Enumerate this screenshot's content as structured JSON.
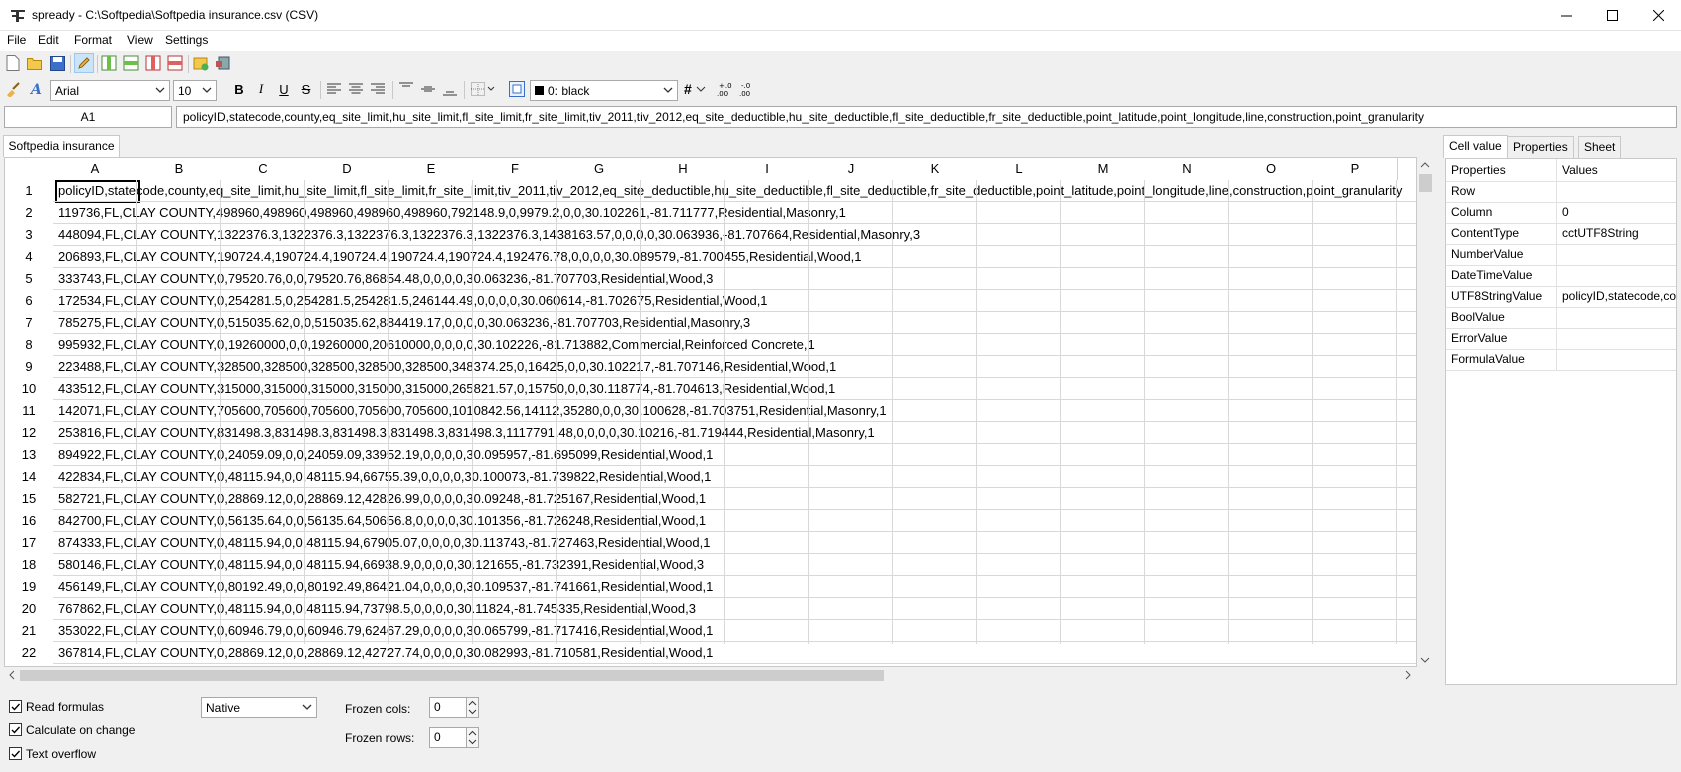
{
  "window": {
    "title": "spready - C:\\Softpedia\\Softpedia insurance.csv (CSV)"
  },
  "menu": [
    "File",
    "Edit",
    "Format",
    "View",
    "Settings"
  ],
  "toolbar": {
    "font_name": "Arial",
    "font_size": "10",
    "bold_label": "B",
    "italic_label": "I",
    "underline_label": "U",
    "strike_label": "S",
    "color_value": "0: black",
    "number_format_label": "#"
  },
  "cell_ref": "A1",
  "formula_value": "policyID,statecode,county,eq_site_limit,hu_site_limit,fl_site_limit,fr_site_limit,tiv_2011,tiv_2012,eq_site_deductible,hu_site_deductible,fl_site_deductible,fr_site_deductible,point_latitude,point_longitude,line,construction,point_granularity",
  "sheet_tab": "Softpedia insurance",
  "columns": [
    "A",
    "B",
    "C",
    "D",
    "E",
    "F",
    "G",
    "H",
    "I",
    "J",
    "K",
    "L",
    "M",
    "N",
    "O",
    "P"
  ],
  "rows": [
    {
      "n": "1",
      "text": "policyID,statecode,county,eq_site_limit,hu_site_limit,fl_site_limit,fr_site_limit,tiv_2011,tiv_2012,eq_site_deductible,hu_site_deductible,fl_site_deductible,fr_site_deductible,point_latitude,point_longitude,line,construction,point_granularity"
    },
    {
      "n": "2",
      "text": "119736,FL,CLAY COUNTY,498960,498960,498960,498960,498960,792148.9,0,9979.2,0,0,30.102261,-81.711777,Residential,Masonry,1"
    },
    {
      "n": "3",
      "text": "448094,FL,CLAY COUNTY,1322376.3,1322376.3,1322376.3,1322376.3,1322376.3,1438163.57,0,0,0,0,30.063936,-81.707664,Residential,Masonry,3"
    },
    {
      "n": "4",
      "text": "206893,FL,CLAY COUNTY,190724.4,190724.4,190724.4,190724.4,190724.4,192476.78,0,0,0,0,30.089579,-81.700455,Residential,Wood,1"
    },
    {
      "n": "5",
      "text": "333743,FL,CLAY COUNTY,0,79520.76,0,0,79520.76,86854.48,0,0,0,0,30.063236,-81.707703,Residential,Wood,3"
    },
    {
      "n": "6",
      "text": "172534,FL,CLAY COUNTY,0,254281.5,0,254281.5,254281.5,246144.49,0,0,0,0,30.060614,-81.702675,Residential,Wood,1"
    },
    {
      "n": "7",
      "text": "785275,FL,CLAY COUNTY,0,515035.62,0,0,515035.62,884419.17,0,0,0,0,30.063236,-81.707703,Residential,Masonry,3"
    },
    {
      "n": "8",
      "text": "995932,FL,CLAY COUNTY,0,19260000,0,0,19260000,20610000,0,0,0,0,30.102226,-81.713882,Commercial,Reinforced Concrete,1"
    },
    {
      "n": "9",
      "text": "223488,FL,CLAY COUNTY,328500,328500,328500,328500,328500,348374.25,0,16425,0,0,30.102217,-81.707146,Residential,Wood,1"
    },
    {
      "n": "10",
      "text": "433512,FL,CLAY COUNTY,315000,315000,315000,315000,315000,265821.57,0,15750,0,0,30.118774,-81.704613,Residential,Wood,1"
    },
    {
      "n": "11",
      "text": "142071,FL,CLAY COUNTY,705600,705600,705600,705600,705600,1010842.56,14112,35280,0,0,30.100628,-81.703751,Residential,Masonry,1"
    },
    {
      "n": "12",
      "text": "253816,FL,CLAY COUNTY,831498.3,831498.3,831498.3,831498.3,831498.3,1117791.48,0,0,0,0,30.10216,-81.719444,Residential,Masonry,1"
    },
    {
      "n": "13",
      "text": "894922,FL,CLAY COUNTY,0,24059.09,0,0,24059.09,33952.19,0,0,0,0,30.095957,-81.695099,Residential,Wood,1"
    },
    {
      "n": "14",
      "text": "422834,FL,CLAY COUNTY,0,48115.94,0,0,48115.94,66755.39,0,0,0,0,30.100073,-81.739822,Residential,Wood,1"
    },
    {
      "n": "15",
      "text": "582721,FL,CLAY COUNTY,0,28869.12,0,0,28869.12,42826.99,0,0,0,0,30.09248,-81.725167,Residential,Wood,1"
    },
    {
      "n": "16",
      "text": "842700,FL,CLAY COUNTY,0,56135.64,0,0,56135.64,50656.8,0,0,0,0,30.101356,-81.726248,Residential,Wood,1"
    },
    {
      "n": "17",
      "text": "874333,FL,CLAY COUNTY,0,48115.94,0,0,48115.94,67905.07,0,0,0,0,30.113743,-81.727463,Residential,Wood,1"
    },
    {
      "n": "18",
      "text": "580146,FL,CLAY COUNTY,0,48115.94,0,0,48115.94,66938.9,0,0,0,0,30.121655,-81.732391,Residential,Wood,3"
    },
    {
      "n": "19",
      "text": "456149,FL,CLAY COUNTY,0,80192.49,0,0,80192.49,86421.04,0,0,0,0,30.109537,-81.741661,Residential,Wood,1"
    },
    {
      "n": "20",
      "text": "767862,FL,CLAY COUNTY,0,48115.94,0,0,48115.94,73798.5,0,0,0,0,30.11824,-81.745335,Residential,Wood,3"
    },
    {
      "n": "21",
      "text": "353022,FL,CLAY COUNTY,0,60946.79,0,0,60946.79,62467.29,0,0,0,0,30.065799,-81.717416,Residential,Wood,1"
    },
    {
      "n": "22",
      "text": "367814,FL,CLAY COUNTY,0,28869.12,0,0,28869.12,42727.74,0,0,0,0,30.082993,-81.710581,Residential,Wood,1"
    }
  ],
  "right_tabs": [
    "Cell value",
    "Properties",
    "Sheet"
  ],
  "props": [
    {
      "name": "Properties",
      "value": "Values"
    },
    {
      "name": "Row",
      "value": ""
    },
    {
      "name": "Column",
      "value": "0"
    },
    {
      "name": "ContentType",
      "value": "cctUTF8String"
    },
    {
      "name": "NumberValue",
      "value": ""
    },
    {
      "name": "DateTimeValue",
      "value": ""
    },
    {
      "name": "UTF8StringValue",
      "value": "policyID,statecode,county"
    },
    {
      "name": "BoolValue",
      "value": ""
    },
    {
      "name": "ErrorValue",
      "value": ""
    },
    {
      "name": "FormulaValue",
      "value": ""
    }
  ],
  "options": {
    "read_formulas": "Read formulas",
    "calc_on_change": "Calculate on change",
    "text_overflow": "Text overflow",
    "mode_value": "Native",
    "frozen_cols_label": "Frozen cols:",
    "frozen_cols_value": "0",
    "frozen_rows_label": "Frozen rows:",
    "frozen_rows_value": "0"
  }
}
